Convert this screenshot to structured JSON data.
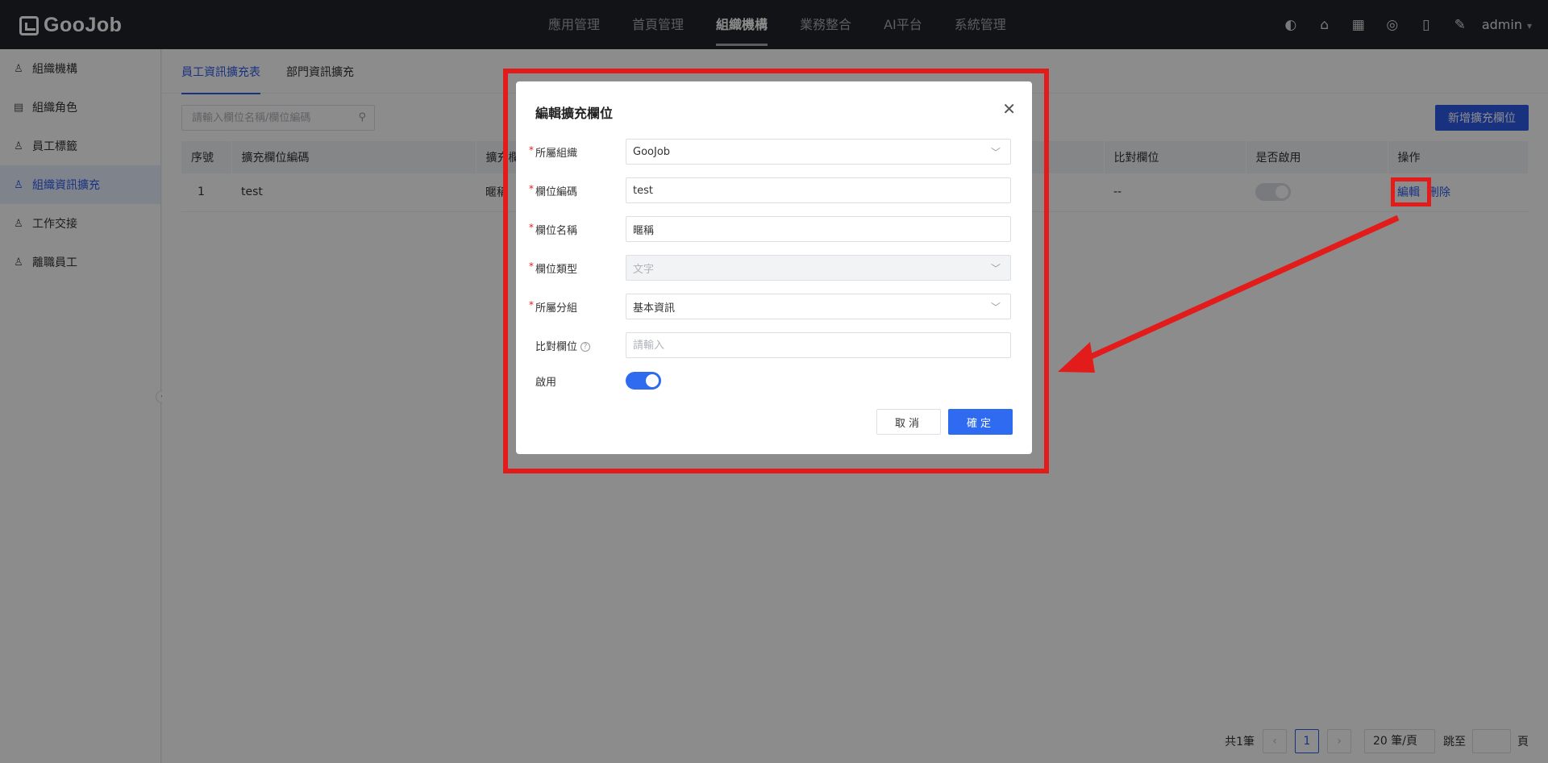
{
  "app": {
    "logo_text": "GooJob"
  },
  "topnav": {
    "items": [
      {
        "label": "應用管理"
      },
      {
        "label": "首頁管理"
      },
      {
        "label": "組織機構"
      },
      {
        "label": "業務整合"
      },
      {
        "label": "AI平台"
      },
      {
        "label": "系統管理"
      }
    ],
    "active_index": 2,
    "user": "admin"
  },
  "sidebar": {
    "items": [
      {
        "label": "組織機構",
        "icon": "org-icon"
      },
      {
        "label": "組織角色",
        "icon": "role-icon"
      },
      {
        "label": "員工標籤",
        "icon": "tag-icon"
      },
      {
        "label": "組織資訊擴充",
        "icon": "user-icon"
      },
      {
        "label": "工作交接",
        "icon": "handover-icon"
      },
      {
        "label": "離職員工",
        "icon": "user-leave-icon"
      }
    ],
    "active_index": 3
  },
  "tabs": [
    {
      "label": "員工資訊擴充表"
    },
    {
      "label": "部門資訊擴充"
    }
  ],
  "search": {
    "placeholder": "請輸入欄位名稱/欄位編碼"
  },
  "add_button": "新增擴充欄位",
  "table": {
    "columns": [
      "序號",
      "擴充欄位編碼",
      "擴充欄",
      "比對欄位",
      "是否啟用",
      "操作"
    ],
    "rows": [
      {
        "index": "1",
        "code": "test",
        "name": "暱稱",
        "compare": "--",
        "enabled": false,
        "edit": "編輯",
        "delete": "刪除"
      }
    ]
  },
  "pager": {
    "total": "共1筆",
    "current_page": "1",
    "page_size": "20 筆/頁",
    "jump_label": "跳至",
    "page_unit": "頁"
  },
  "dialog": {
    "title": "編輯擴充欄位",
    "fields": [
      {
        "label": "所屬組織",
        "value": "GooJob",
        "required": true,
        "type": "select"
      },
      {
        "label": "欄位編碼",
        "value": "test",
        "required": true,
        "type": "input"
      },
      {
        "label": "欄位名稱",
        "value": "暱稱",
        "required": true,
        "type": "input"
      },
      {
        "label": "欄位類型",
        "value": "文字",
        "required": true,
        "type": "select-disabled"
      },
      {
        "label": "所屬分組",
        "value": "基本資訊",
        "required": true,
        "type": "select"
      },
      {
        "label": "比對欄位",
        "placeholder": "請輸入",
        "required": false,
        "type": "input"
      }
    ],
    "enable_label": "啟用",
    "enabled": true,
    "cancel_label": "取消",
    "ok_label": "確定"
  },
  "colors": {
    "primary": "#2f5bea",
    "header_bg": "#20232b",
    "annotation_red": "#e21b1b"
  }
}
